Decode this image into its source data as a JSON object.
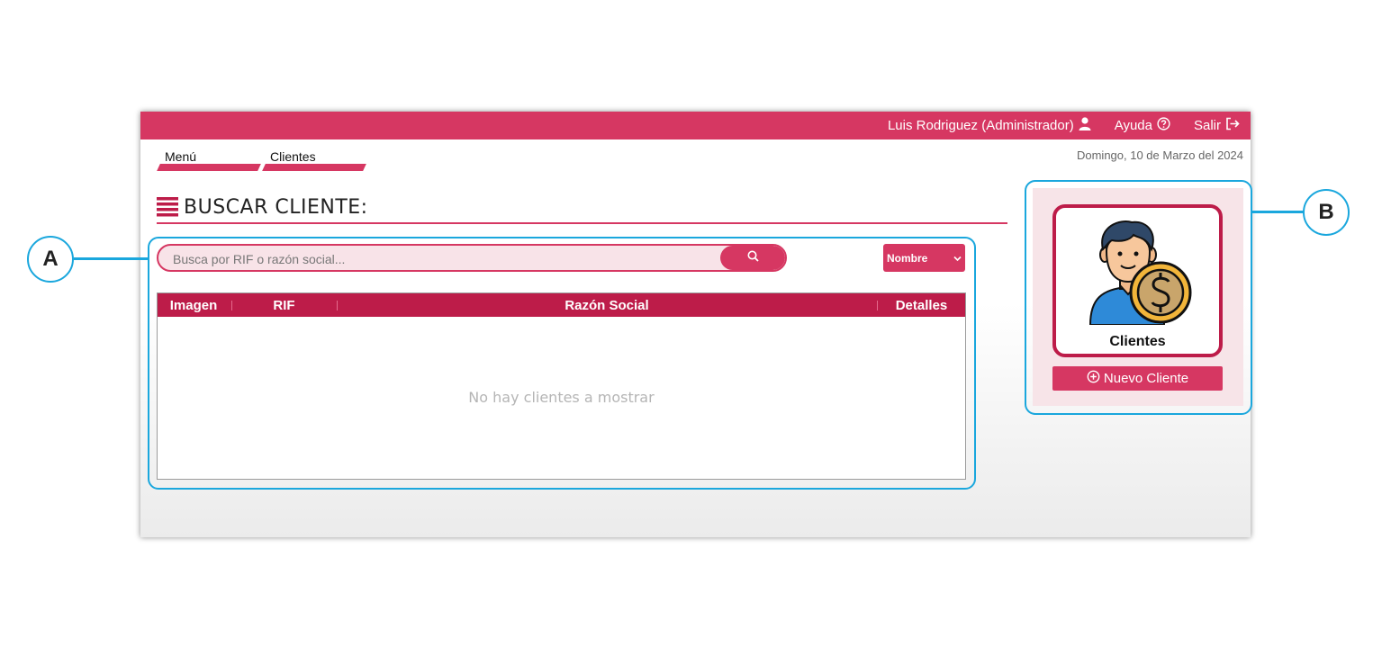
{
  "topbar": {
    "user_label": "Luis Rodriguez (Administrador)",
    "help_label": "Ayuda",
    "exit_label": "Salir",
    "user_icon": "user-icon",
    "help_icon": "question-circle-icon",
    "exit_icon": "sign-out-icon"
  },
  "breadcrumb": {
    "items": [
      {
        "label": "Menú"
      },
      {
        "label": "Clientes"
      }
    ]
  },
  "date": "Domingo, 10 de Marzo del 2024",
  "page_title": "BUSCAR CLIENTE:",
  "search": {
    "placeholder": "Busca por RIF o razón social...",
    "value": "",
    "button_icon": "search-icon"
  },
  "sort_select": {
    "selected": "Nombre"
  },
  "table": {
    "columns": [
      "Imagen",
      "RIF",
      "Razón Social",
      "Detalles"
    ],
    "empty_message": "No hay clientes a mostrar"
  },
  "side_panel": {
    "card_label": "Clientes",
    "card_icon": "client-coin-icon",
    "new_button_label": "Nuevo Cliente",
    "new_button_icon": "plus-circle-icon"
  },
  "annotations": {
    "a": "A",
    "b": "B"
  },
  "colors": {
    "primary": "#d63762",
    "header_dark": "#bd1c49",
    "search_bg": "#f8e3e8",
    "callout": "#1aa7dd"
  }
}
